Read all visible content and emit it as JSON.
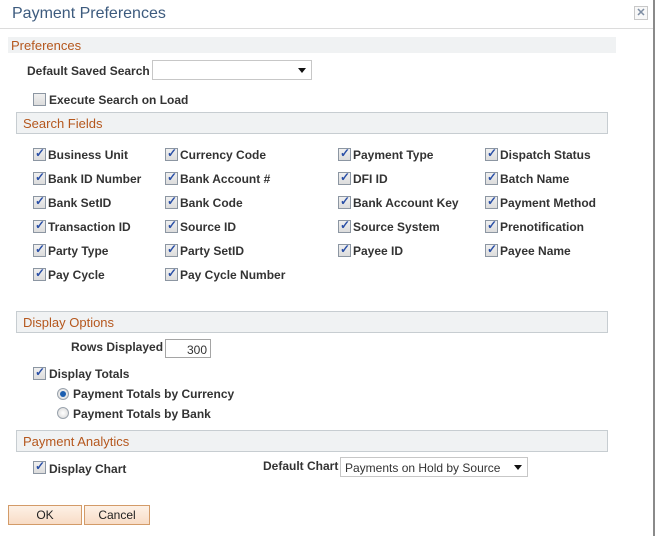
{
  "dialog": {
    "title": "Payment Preferences",
    "close_icon": "close-icon"
  },
  "preferences": {
    "header": "Preferences",
    "default_saved_search_label": "Default Saved Search",
    "default_saved_search_value": "",
    "execute_search_label": "Execute Search on Load",
    "execute_search_checked": false
  },
  "search_fields": {
    "header": "Search Fields",
    "columns": [
      [
        {
          "label": "Business Unit",
          "checked": true
        },
        {
          "label": "Bank ID Number",
          "checked": true
        },
        {
          "label": "Bank SetID",
          "checked": true
        },
        {
          "label": "Transaction ID",
          "checked": true
        },
        {
          "label": "Party Type",
          "checked": true
        },
        {
          "label": "Pay Cycle",
          "checked": true
        }
      ],
      [
        {
          "label": "Currency Code",
          "checked": true
        },
        {
          "label": "Bank Account #",
          "checked": true
        },
        {
          "label": "Bank Code",
          "checked": true
        },
        {
          "label": "Source ID",
          "checked": true
        },
        {
          "label": "Party SetID",
          "checked": true
        },
        {
          "label": "Pay Cycle Number",
          "checked": true
        }
      ],
      [
        {
          "label": "Payment Type",
          "checked": true
        },
        {
          "label": "DFI ID",
          "checked": true
        },
        {
          "label": "Bank Account Key",
          "checked": true
        },
        {
          "label": "Source System",
          "checked": true
        },
        {
          "label": "Payee ID",
          "checked": true
        }
      ],
      [
        {
          "label": "Dispatch Status",
          "checked": true
        },
        {
          "label": "Batch Name",
          "checked": true
        },
        {
          "label": "Payment Method",
          "checked": true
        },
        {
          "label": "Prenotification",
          "checked": true
        },
        {
          "label": "Payee Name",
          "checked": true
        }
      ]
    ]
  },
  "display_options": {
    "header": "Display Options",
    "rows_displayed_label": "Rows Displayed",
    "rows_displayed_value": "300",
    "display_totals_label": "Display Totals",
    "display_totals_checked": true,
    "totals_options": [
      {
        "label": "Payment Totals by Currency",
        "selected": true
      },
      {
        "label": "Payment Totals by Bank",
        "selected": false
      }
    ]
  },
  "payment_analytics": {
    "header": "Payment Analytics",
    "display_chart_label": "Display Chart",
    "display_chart_checked": true,
    "default_chart_label": "Default Chart",
    "default_chart_value": "Payments on Hold by Source"
  },
  "buttons": {
    "ok": "OK",
    "cancel": "Cancel"
  }
}
